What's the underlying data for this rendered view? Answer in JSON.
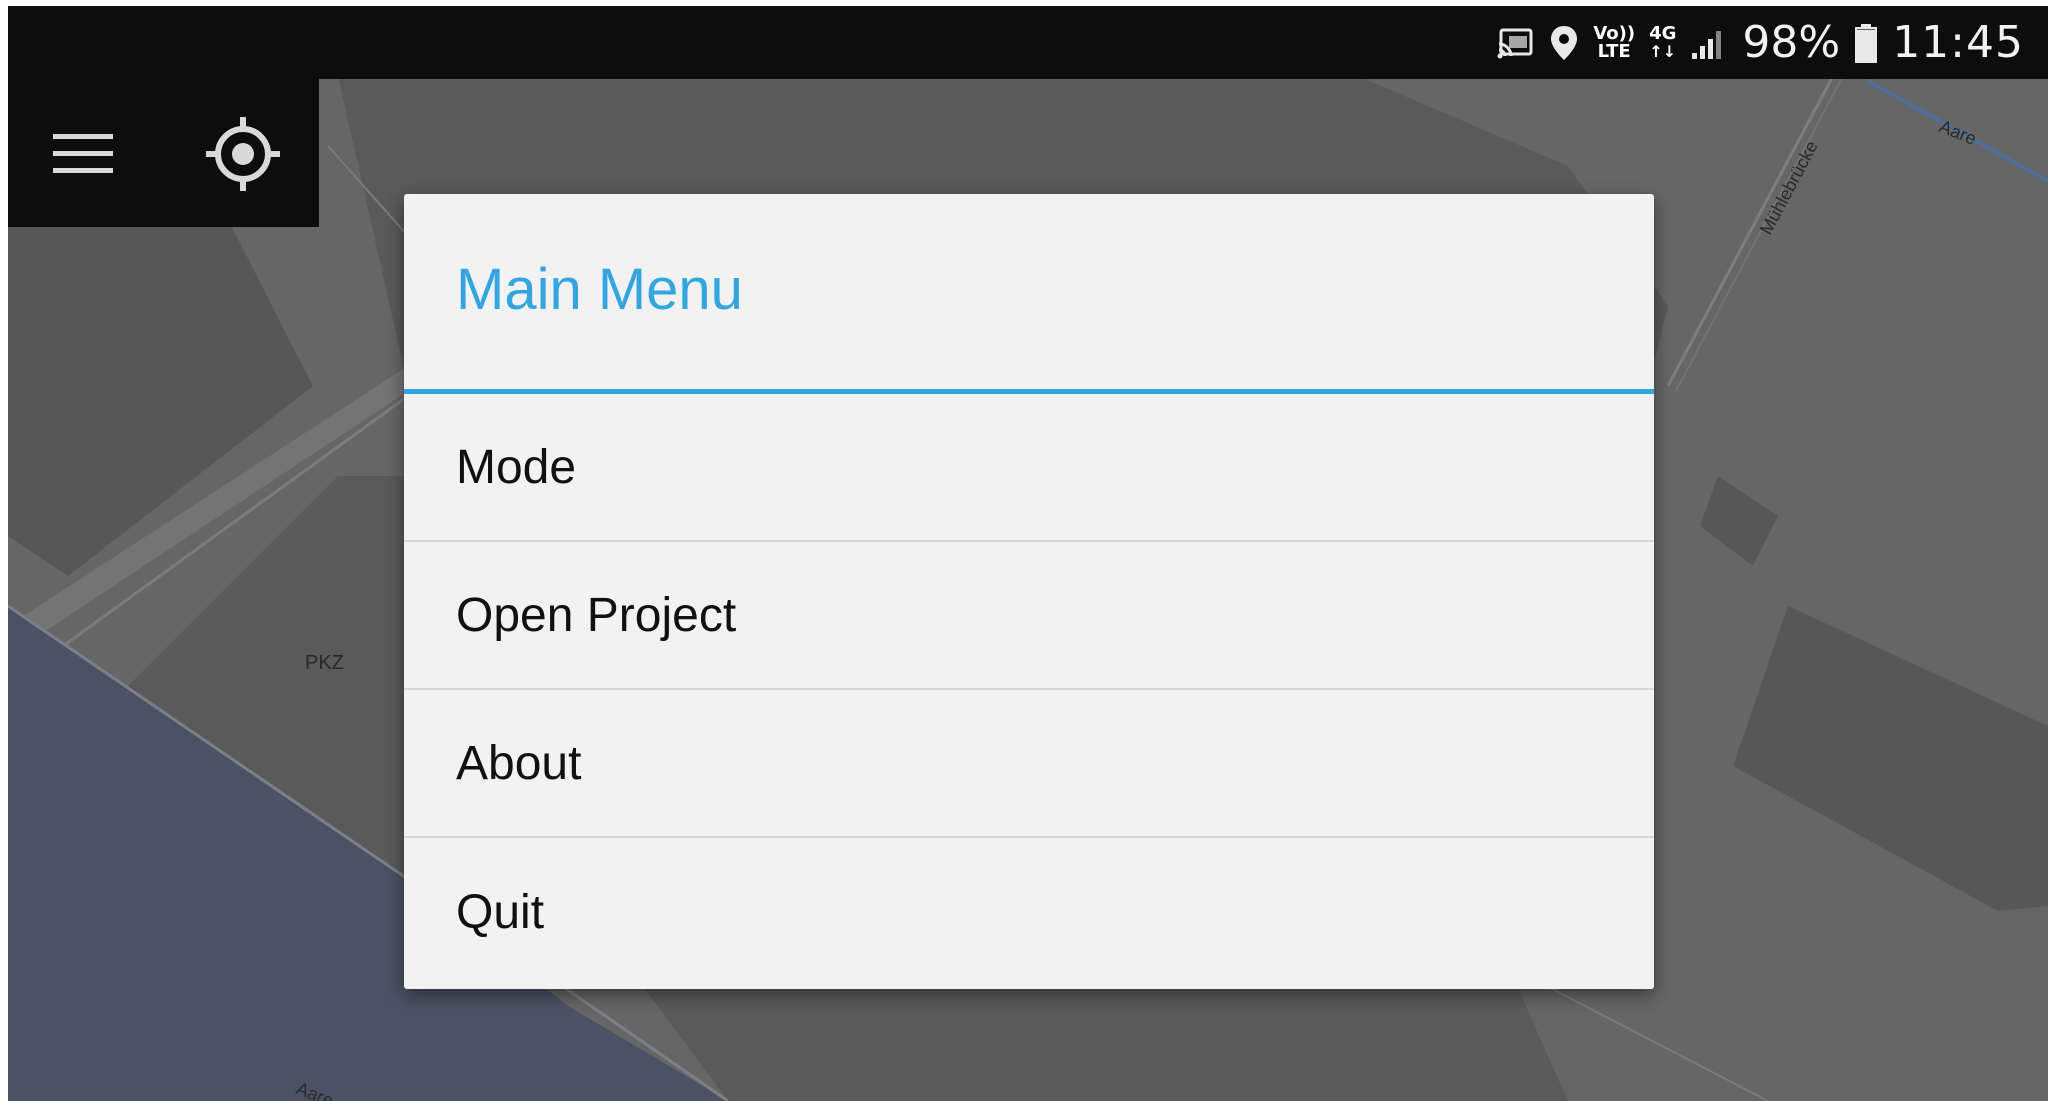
{
  "status_bar": {
    "icons": [
      "cast-icon",
      "location-pin-icon",
      "volte-icon",
      "4g-data-icon",
      "signal-icon",
      "battery-icon"
    ],
    "volte_top": "Vo))",
    "volte_bottom": "LTE",
    "network_label": "4G",
    "battery_percent": "98%",
    "battery_level": 0.98,
    "time": "11:45"
  },
  "toolbar": {
    "menu_icon": "hamburger-menu-icon",
    "locate_icon": "crosshair-locate-icon"
  },
  "map": {
    "labels": {
      "pkz": "PKZ",
      "aare_top": "Aare",
      "aare_bottom": "Aare",
      "bridge": "Mühlebrücke"
    }
  },
  "dialog": {
    "title": "Main Menu",
    "accent_color": "#33a5df",
    "items": [
      {
        "label": "Mode"
      },
      {
        "label": "Open Project"
      },
      {
        "label": "About"
      },
      {
        "label": "Quit"
      }
    ]
  }
}
